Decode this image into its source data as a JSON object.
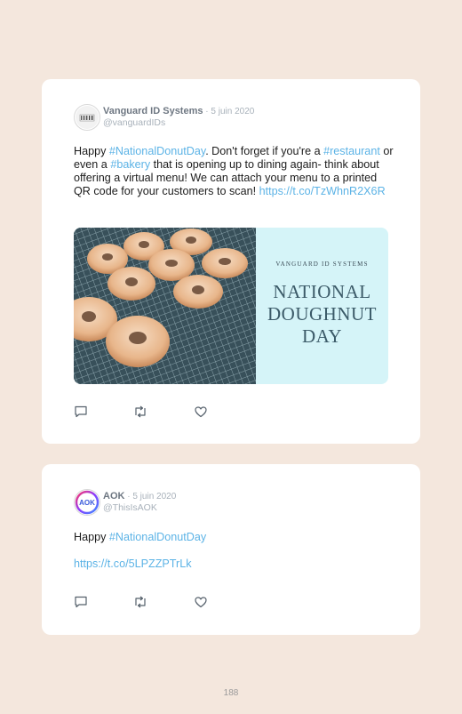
{
  "tweets": [
    {
      "display_name": "Vanguard ID Systems",
      "separator": " · ",
      "date": "5 juin 2020",
      "handle": "@vanguardIDs",
      "text": {
        "p1": "Happy ",
        "tag1": "#NationalDonutDay",
        "p2": ". Don't forget if you're a ",
        "tag2": "#restaurant",
        "p3": " or even a ",
        "tag3": "#bakery",
        "p4": " that is opening up to dining again- think about offering a virtual menu! We can attach your menu to a printed QR code for your customers to scan! ",
        "link": "https://t.co/TzWhnR2X6R"
      },
      "media": {
        "brand": "VANGUARD ID SYSTEMS",
        "title_line1": "NATIONAL",
        "title_line2": "DOUGHNUT",
        "title_line3": "DAY"
      },
      "icons": [
        "reply-icon",
        "retweet-icon",
        "like-icon"
      ]
    },
    {
      "display_name": "AOK",
      "separator": " · ",
      "date": "5 juin 2020",
      "handle": "@ThisIsAOK",
      "avatar_text": "AOK",
      "text": {
        "p1": "Happy ",
        "tag1": "#NationalDonutDay",
        "link": "https://t.co/5LPZZPTrLk"
      },
      "icons": [
        "reply-icon",
        "retweet-icon",
        "like-icon"
      ]
    }
  ],
  "page_number": "188",
  "colors": {
    "background": "#f4e7dd",
    "card": "#ffffff",
    "link": "#5cb3e6",
    "media_panel": "#d5f4f8"
  }
}
